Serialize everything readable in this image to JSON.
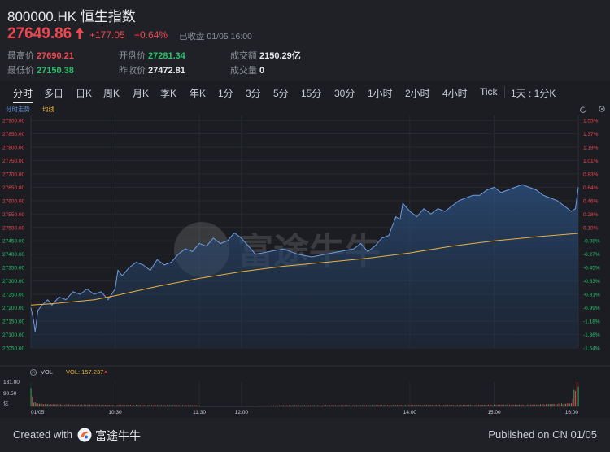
{
  "quote": {
    "symbol_title": "800000.HK 恒生指数",
    "last_price": "27649.86",
    "change": "+177.05",
    "change_pct": "+0.64%",
    "status": "已收盘  01/05 16:00",
    "up_color": "#f0474f",
    "down_color": "#27c26d"
  },
  "stats": [
    {
      "label": "最高价",
      "value": "27690.21",
      "color": "red"
    },
    {
      "label": "最低价",
      "value": "27150.38",
      "color": "green"
    },
    {
      "label": "开盘价",
      "value": "27281.34",
      "color": "green"
    },
    {
      "label": "昨收价",
      "value": "27472.81",
      "color": "white"
    },
    {
      "label": "成交额",
      "value": "2150.29亿",
      "color": "white"
    },
    {
      "label": "成交量",
      "value": "0",
      "color": "white"
    }
  ],
  "tabs": [
    "分时",
    "多日",
    "日K",
    "周K",
    "月K",
    "季K",
    "年K",
    "1分",
    "3分",
    "5分",
    "15分",
    "30分",
    "1小时",
    "2小时",
    "4小时",
    "Tick",
    "1天 : 1分K"
  ],
  "active_tab": "分时",
  "chart_labels": {
    "mode": "分时走势",
    "avg_legend": "均线",
    "vol_label": "VOL",
    "vol_value": "VOL: 157.237",
    "watermark": "富途牛牛"
  },
  "chart_data": {
    "type": "line",
    "title": "",
    "series": [
      {
        "name": "分时走势",
        "color": "#6f9be0"
      },
      {
        "name": "均线",
        "color": "#e8b23a"
      }
    ],
    "price_ticks": [
      "27900.00",
      "27850.00",
      "27800.00",
      "27750.00",
      "27700.00",
      "27650.00",
      "27600.00",
      "27550.00",
      "27500.00",
      "27450.00",
      "27400.00",
      "27350.00",
      "27300.00",
      "27250.00",
      "27200.00",
      "27150.00",
      "27100.00",
      "27050.00"
    ],
    "pct_ticks": [
      "1.55%",
      "1.37%",
      "1.19%",
      "1.01%",
      "0.83%",
      "0.64%",
      "0.46%",
      "0.28%",
      "0.10%",
      "-0.08%",
      "-0.27%",
      "-0.45%",
      "-0.63%",
      "-0.81%",
      "-0.99%",
      "-1.18%",
      "-1.36%",
      "-1.54%"
    ],
    "ylim": [
      27050,
      27900
    ],
    "time_ticks": [
      "01/05",
      "10:30",
      "11:30",
      "12:00",
      "14:00",
      "15:00",
      "16:00"
    ],
    "time_tick_min": [
      0,
      60,
      120,
      150,
      270,
      330,
      390
    ],
    "vol_ticks": [
      "181.00",
      "90.50",
      "亿"
    ],
    "price": [
      [
        0,
        27200
      ],
      [
        2,
        27150
      ],
      [
        3,
        27110
      ],
      [
        5,
        27190
      ],
      [
        8,
        27210
      ],
      [
        12,
        27230
      ],
      [
        15,
        27210
      ],
      [
        20,
        27240
      ],
      [
        25,
        27230
      ],
      [
        30,
        27260
      ],
      [
        35,
        27250
      ],
      [
        40,
        27270
      ],
      [
        45,
        27250
      ],
      [
        50,
        27260
      ],
      [
        55,
        27230
      ],
      [
        60,
        27270
      ],
      [
        62,
        27340
      ],
      [
        65,
        27320
      ],
      [
        70,
        27350
      ],
      [
        75,
        27370
      ],
      [
        80,
        27360
      ],
      [
        85,
        27340
      ],
      [
        90,
        27380
      ],
      [
        95,
        27360
      ],
      [
        100,
        27370
      ],
      [
        105,
        27400
      ],
      [
        110,
        27420
      ],
      [
        115,
        27410
      ],
      [
        120,
        27440
      ],
      [
        125,
        27430
      ],
      [
        130,
        27460
      ],
      [
        135,
        27440
      ],
      [
        140,
        27450
      ],
      [
        145,
        27480
      ],
      [
        150,
        27460
      ],
      [
        155,
        27430
      ],
      [
        160,
        27400
      ],
      [
        170,
        27410
      ],
      [
        180,
        27420
      ],
      [
        190,
        27400
      ],
      [
        200,
        27390
      ],
      [
        210,
        27400
      ],
      [
        220,
        27410
      ],
      [
        230,
        27420
      ],
      [
        235,
        27440
      ],
      [
        240,
        27410
      ],
      [
        245,
        27430
      ],
      [
        250,
        27460
      ],
      [
        255,
        27470
      ],
      [
        260,
        27540
      ],
      [
        263,
        27530
      ],
      [
        265,
        27590
      ],
      [
        270,
        27560
      ],
      [
        275,
        27540
      ],
      [
        280,
        27570
      ],
      [
        285,
        27550
      ],
      [
        290,
        27570
      ],
      [
        295,
        27560
      ],
      [
        300,
        27580
      ],
      [
        305,
        27600
      ],
      [
        310,
        27610
      ],
      [
        315,
        27620
      ],
      [
        320,
        27620
      ],
      [
        325,
        27640
      ],
      [
        330,
        27650
      ],
      [
        335,
        27630
      ],
      [
        340,
        27640
      ],
      [
        345,
        27650
      ],
      [
        350,
        27660
      ],
      [
        355,
        27650
      ],
      [
        360,
        27640
      ],
      [
        365,
        27620
      ],
      [
        370,
        27610
      ],
      [
        375,
        27600
      ],
      [
        380,
        27580
      ],
      [
        385,
        27560
      ],
      [
        388,
        27570
      ],
      [
        390,
        27650
      ]
    ],
    "avg": [
      [
        0,
        27210
      ],
      [
        15,
        27215
      ],
      [
        30,
        27222
      ],
      [
        45,
        27230
      ],
      [
        60,
        27245
      ],
      [
        90,
        27280
      ],
      [
        120,
        27310
      ],
      [
        150,
        27335
      ],
      [
        180,
        27355
      ],
      [
        210,
        27370
      ],
      [
        240,
        27385
      ],
      [
        270,
        27405
      ],
      [
        300,
        27430
      ],
      [
        330,
        27450
      ],
      [
        360,
        27465
      ],
      [
        390,
        27478
      ]
    ],
    "volume": [
      [
        0,
        181
      ],
      [
        1,
        60
      ],
      [
        2,
        30
      ],
      [
        5,
        18
      ],
      [
        10,
        15
      ],
      [
        30,
        12
      ],
      [
        60,
        10
      ],
      [
        90,
        9
      ],
      [
        120,
        8
      ],
      [
        150,
        2
      ],
      [
        180,
        8
      ],
      [
        210,
        8
      ],
      [
        240,
        9
      ],
      [
        270,
        10
      ],
      [
        300,
        10
      ],
      [
        330,
        11
      ],
      [
        360,
        12
      ],
      [
        385,
        20
      ],
      [
        389,
        181
      ]
    ]
  },
  "footer": {
    "created_with": "Created with",
    "brand": "富途牛牛",
    "published": "Published on CN 01/05"
  }
}
